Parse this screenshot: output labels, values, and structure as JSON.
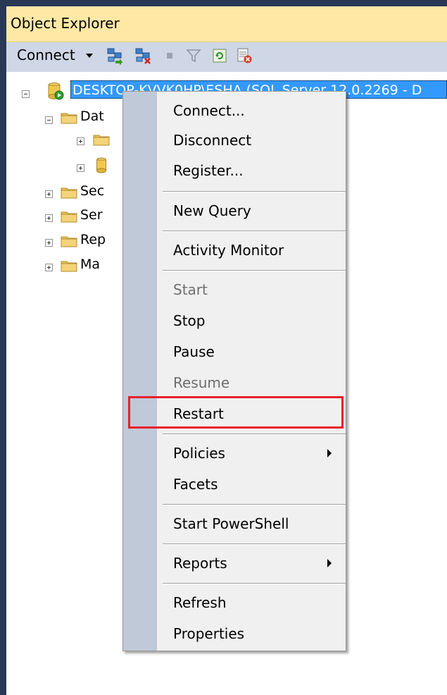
{
  "panel": {
    "title": "Object Explorer"
  },
  "toolbar": {
    "connect_label": "Connect"
  },
  "tree": {
    "server_label": "DESKTOP-KVVK0HP\\ESHA (SQL Server 12.0.2269 - D",
    "nodes": [
      {
        "label": "Dat"
      },
      {
        "label": ""
      },
      {
        "label": ""
      },
      {
        "label": "Sec"
      },
      {
        "label": "Ser"
      },
      {
        "label": "Rep"
      },
      {
        "label": "Ma"
      }
    ]
  },
  "context_menu": {
    "items": [
      {
        "label": "Connect..."
      },
      {
        "label": "Disconnect"
      },
      {
        "label": "Register..."
      },
      {
        "label": "New Query"
      },
      {
        "label": "Activity Monitor"
      },
      {
        "label": "Start"
      },
      {
        "label": "Stop"
      },
      {
        "label": "Pause"
      },
      {
        "label": "Resume"
      },
      {
        "label": "Restart"
      },
      {
        "label": "Policies"
      },
      {
        "label": "Facets"
      },
      {
        "label": "Start PowerShell"
      },
      {
        "label": "Reports"
      },
      {
        "label": "Refresh"
      },
      {
        "label": "Properties"
      }
    ],
    "disabled": [
      "Start",
      "Resume"
    ],
    "highlighted": "Restart",
    "highlight_color": "#e8202a"
  },
  "colors": {
    "selection": "#3399ff",
    "titlebar": "#ffe8a6",
    "toolbar": "#cfd6e5",
    "menu_gutter": "#bfc9d8"
  }
}
